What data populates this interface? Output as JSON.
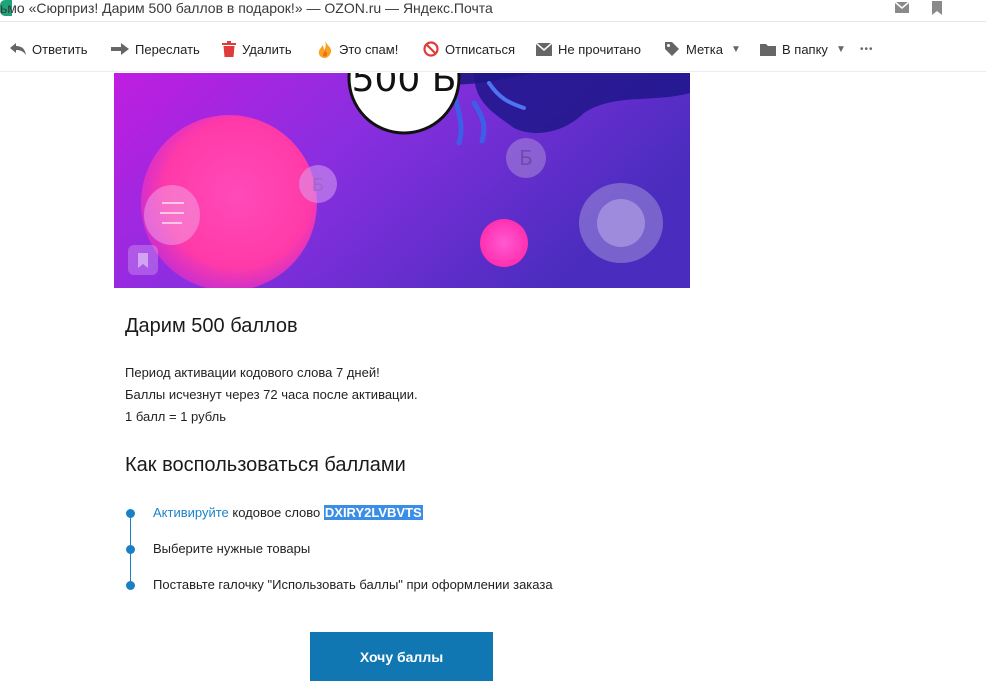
{
  "window": {
    "title": "ьмо «Сюрприз! Дарим 500 баллов в подарок!» — OZON.ru — Яндекс.Почта"
  },
  "toolbar": {
    "reply": "Ответить",
    "forward": "Переслать",
    "delete": "Удалить",
    "spam": "Это спам!",
    "unsubscribe": "Отписаться",
    "unread": "Не прочитано",
    "label": "Метка",
    "folder": "В папку",
    "more": "•••"
  },
  "banner": {
    "coin_text": "500 Б",
    "coin_symbol": "Б",
    "colors": {
      "bg_start": "#c21fe0",
      "bg_end": "#5a2bd0",
      "pink": "#ff3fbf"
    }
  },
  "email": {
    "heading": "Дарим 500 баллов",
    "paragraphs": [
      "Период активации кодового слова 7 дней!",
      "Баллы исчезнут через 72 часа после активации.",
      "1 балл = 1 рубль"
    ],
    "howto_heading": "Как воспользоваться баллами",
    "steps": {
      "step1_link": "Активируйте",
      "step1_text": " кодовое слово ",
      "step1_code": "DXIRY2LVBVTS",
      "step2": "Выберите нужные товары",
      "step3": "Поставьте галочку \"Использовать баллы\" при оформлении заказа"
    },
    "cta_label": "Хочу баллы",
    "accent_color": "#1077b2"
  }
}
